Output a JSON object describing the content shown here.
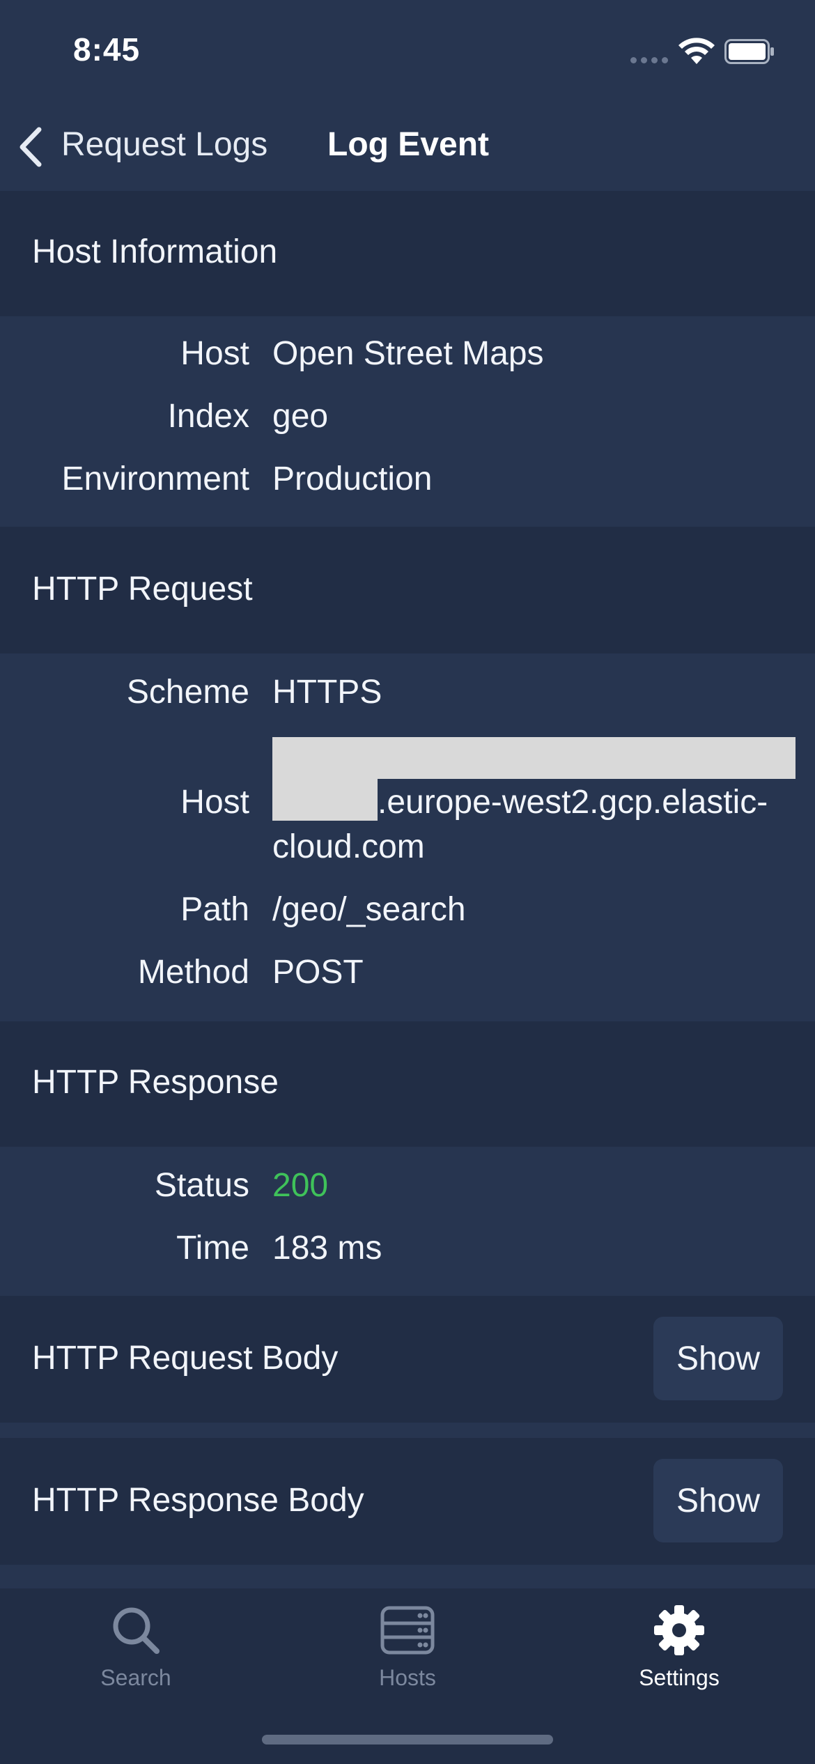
{
  "status_bar": {
    "time": "8:45"
  },
  "nav": {
    "back_label": "Request Logs",
    "title": "Log Event"
  },
  "host_information": {
    "header": "Host Information",
    "rows": [
      {
        "label": "Host",
        "value": "Open Street Maps"
      },
      {
        "label": "Index",
        "value": "geo"
      },
      {
        "label": "Environment",
        "value": "Production"
      }
    ]
  },
  "http_request": {
    "header": "HTTP Request",
    "scheme": {
      "label": "Scheme",
      "value": "HTTPS"
    },
    "host": {
      "label": "Host",
      "value_line1": ".europe-west2.gcp.elastic-",
      "value_line2": "cloud.com"
    },
    "path": {
      "label": "Path",
      "value": "/geo/_search"
    },
    "method": {
      "label": "Method",
      "value": "POST"
    }
  },
  "http_response": {
    "header": "HTTP Response",
    "status": {
      "label": "Status",
      "value": "200",
      "color": "#3fc25a"
    },
    "time": {
      "label": "Time",
      "value": "183 ms"
    }
  },
  "request_body": {
    "header": "HTTP Request Body",
    "button": "Show"
  },
  "response_body": {
    "header": "HTTP Response Body",
    "button": "Show"
  },
  "tab_bar": {
    "tabs": [
      {
        "label": "Search",
        "icon": "search-icon",
        "active": false
      },
      {
        "label": "Hosts",
        "icon": "server-icon",
        "active": false
      },
      {
        "label": "Settings",
        "icon": "gear-icon",
        "active": true
      }
    ]
  },
  "colors": {
    "background": "#273550",
    "section_header": "#212d45",
    "success": "#3fc25a"
  }
}
